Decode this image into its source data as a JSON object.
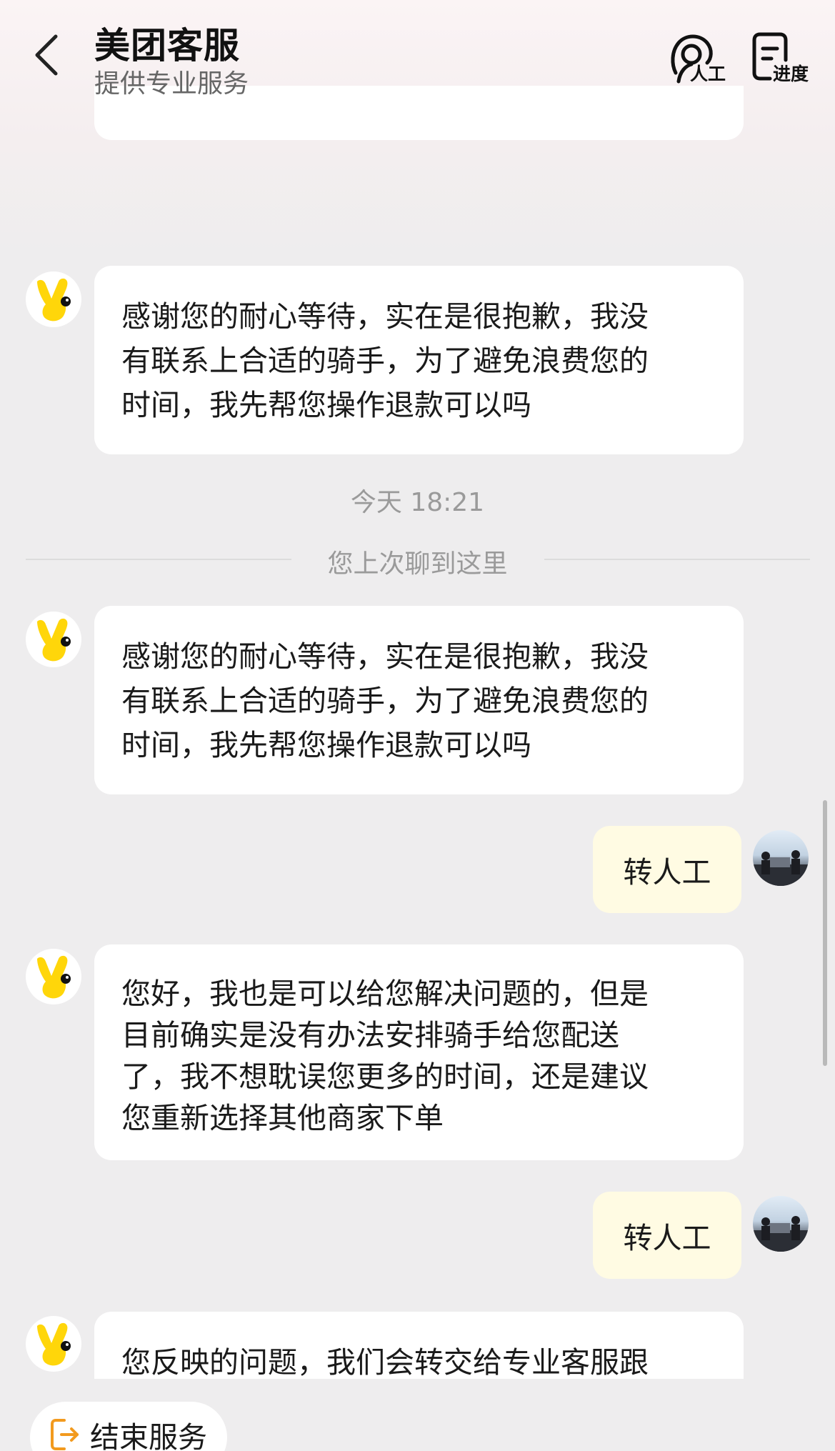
{
  "header": {
    "title": "美团客服",
    "subtitle": "提供专业服务",
    "human_label": "人工",
    "progress_label": "进度"
  },
  "messages": [
    {
      "from": "agent",
      "text_lines": [
        "感谢您的耐心等待，实在是很抱歉，我没",
        "有联系上合适的骑手，为了避免浪费您的",
        "时间，我先帮您操作退款可以吗"
      ]
    },
    {
      "from": "agent",
      "text_lines": [
        "感谢您的耐心等待，实在是很抱歉，我没",
        "有联系上合适的骑手，为了避免浪费您的",
        "时间，我先帮您操作退款可以吗"
      ]
    },
    {
      "from": "user",
      "text": "转人工"
    },
    {
      "from": "agent",
      "text_lines": [
        "您好，我也是可以给您解决问题的，但是",
        "目前确实是没有办法安排骑手给您配送",
        "了，我不想耽误您更多的时间，还是建议",
        "您重新选择其他商家下单"
      ]
    },
    {
      "from": "user",
      "text": "转人工"
    },
    {
      "from": "agent",
      "text_lines": [
        "您反映的问题，我们会转交给专业客服跟"
      ]
    }
  ],
  "timestamp": "今天 18:21",
  "divider_text": "您上次聊到这里",
  "end_service_label": "结束服务",
  "colors": {
    "user_bubble": "#fffbe3",
    "agent_bubble": "#ffffff",
    "accent": "#f29a1e",
    "mascot_yellow": "#ffd60a"
  }
}
